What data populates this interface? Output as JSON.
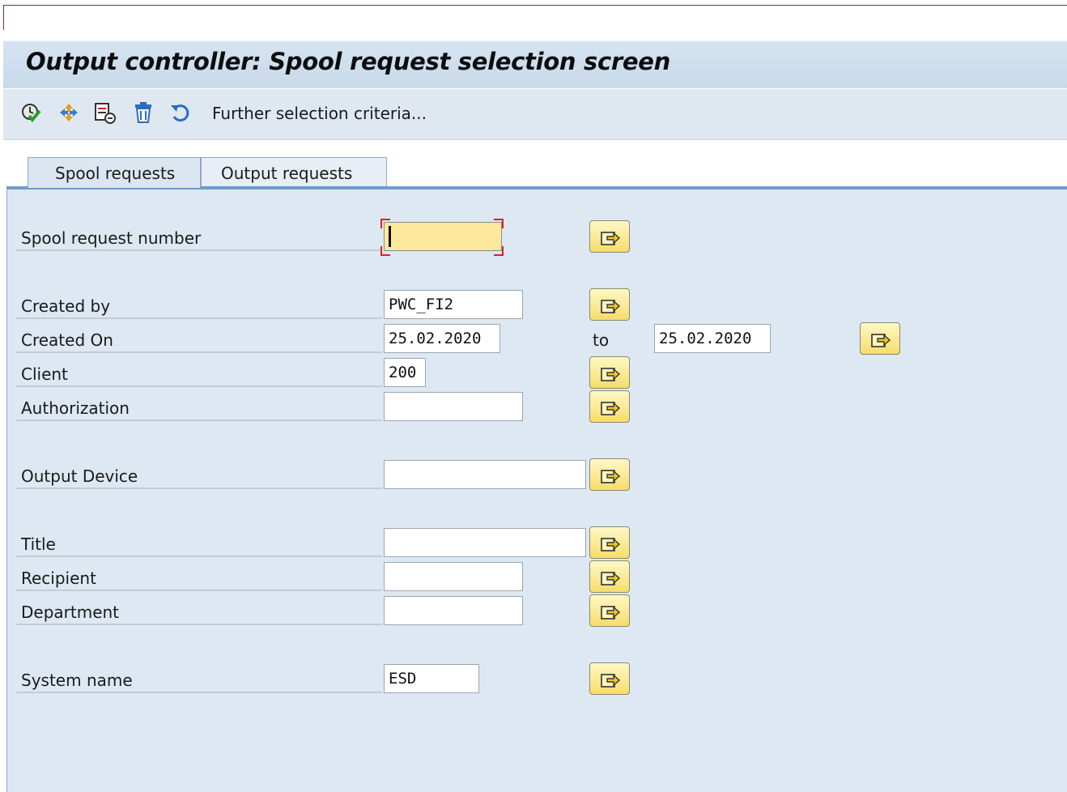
{
  "window": {
    "title": "Output controller: Spool request selection screen"
  },
  "toolbar": {
    "icons": [
      "execute-icon",
      "get-variant-icon",
      "selection-options-icon",
      "delete-icon",
      "undo-icon"
    ],
    "further_label": "Further selection criteria..."
  },
  "tabs": [
    {
      "label": "Spool requests",
      "active": true
    },
    {
      "label": "Output requests",
      "active": false
    }
  ],
  "fields": {
    "spool_request_number": {
      "label": "Spool request number",
      "value": ""
    },
    "created_by": {
      "label": "Created by",
      "value": "PWC_FI2"
    },
    "created_on": {
      "label": "Created On",
      "from": "25.02.2020",
      "to_label": "to",
      "to": "25.02.2020"
    },
    "client": {
      "label": "Client",
      "value": "200"
    },
    "authorization": {
      "label": "Authorization",
      "value": ""
    },
    "output_device": {
      "label": "Output Device",
      "value": ""
    },
    "title": {
      "label": "Title",
      "value": ""
    },
    "recipient": {
      "label": "Recipient",
      "value": ""
    },
    "department": {
      "label": "Department",
      "value": ""
    },
    "system_name": {
      "label": "System name",
      "value": "ESD"
    }
  },
  "icons": {
    "multiple_selection": "multiple-selection-arrow-icon"
  },
  "colors": {
    "title_bar": "#d6e4f2",
    "panel": "#dde8f2",
    "focused_field": "#fde99b",
    "focus_corners": "#dd2222",
    "button": "#f5dd6a"
  }
}
